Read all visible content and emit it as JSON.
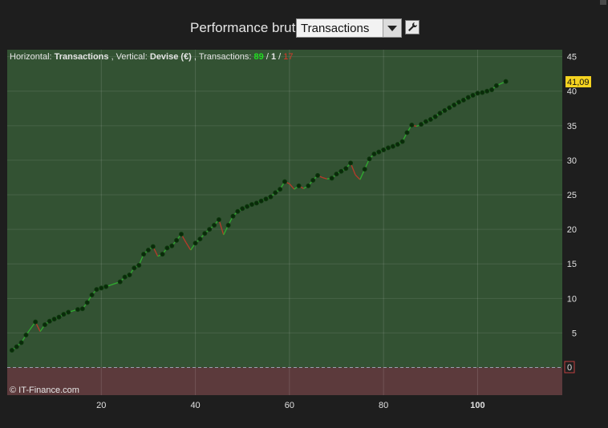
{
  "toolbar": {
    "title": "Performance brute",
    "select_value": "Transactions",
    "wrench_icon": "wrench-icon"
  },
  "info": {
    "horizontal_label": "Horizontal:",
    "horizontal_value": "Transactions",
    "vertical_label": ", Vertical:",
    "vertical_value": "Devise (€)",
    "transactions_label": ", Transactions:",
    "count_win": "89",
    "count_even": "1",
    "count_loss": "17",
    "sep": " / "
  },
  "watermark": "© IT-Finance.com",
  "current_value_label": "41,09",
  "zero_label": "0",
  "colors": {
    "profit_zone": "#335233",
    "loss_zone": "#5c3a3c",
    "up_line": "#2fae2f",
    "down_line": "#b83a2a",
    "marker": "#0a2a0a",
    "win_text": "#22dd22",
    "loss_text": "#d83a2a",
    "value_badge": "#f5d320"
  },
  "chart_data": {
    "type": "line",
    "xlabel": "",
    "ylabel": "",
    "xlim": [
      0,
      118
    ],
    "ylim": [
      -4,
      46
    ],
    "x_ticks": [
      "20",
      "40",
      "60",
      "80",
      "100"
    ],
    "x_tick_values": [
      20,
      40,
      60,
      80,
      100
    ],
    "y_ticks": [
      "5",
      "10",
      "15",
      "20",
      "25",
      "30",
      "35",
      "40",
      "45"
    ],
    "y_tick_values": [
      5,
      10,
      15,
      20,
      25,
      30,
      35,
      40,
      45
    ],
    "grid": true,
    "series": [
      {
        "values": [
          [
            1,
            2.5
          ],
          [
            2,
            3
          ],
          [
            3,
            3.6
          ],
          [
            4,
            4.7
          ],
          [
            6,
            6.6
          ],
          [
            7,
            5.2
          ],
          [
            8,
            6.2
          ],
          [
            9,
            6.7
          ],
          [
            10,
            7
          ],
          [
            11,
            7.3
          ],
          [
            12,
            7.7
          ],
          [
            13,
            8
          ],
          [
            15,
            8.4
          ],
          [
            16,
            8.5
          ],
          [
            17,
            9.4
          ],
          [
            18,
            10.5
          ],
          [
            19,
            11.3
          ],
          [
            20,
            11.5
          ],
          [
            21,
            11.7
          ],
          [
            24,
            12.4
          ],
          [
            25,
            13.1
          ],
          [
            26,
            13.4
          ],
          [
            27,
            14.4
          ],
          [
            28,
            14.8
          ],
          [
            29,
            16.4
          ],
          [
            30,
            17
          ],
          [
            31,
            17.5
          ],
          [
            32,
            16.1
          ],
          [
            33,
            16.4
          ],
          [
            34,
            17.3
          ],
          [
            35,
            17.6
          ],
          [
            36,
            18.4
          ],
          [
            37,
            19.3
          ],
          [
            38,
            18.1
          ],
          [
            39,
            17
          ],
          [
            40,
            18
          ],
          [
            41,
            18.6
          ],
          [
            42,
            19.4
          ],
          [
            43,
            20
          ],
          [
            44,
            20.6
          ],
          [
            45,
            21.4
          ],
          [
            46,
            19.2
          ],
          [
            47,
            20.6
          ],
          [
            48,
            21.9
          ],
          [
            49,
            22.6
          ],
          [
            50,
            23
          ],
          [
            51,
            23.3
          ],
          [
            52,
            23.6
          ],
          [
            53,
            23.8
          ],
          [
            54,
            24.1
          ],
          [
            55,
            24.4
          ],
          [
            56,
            24.7
          ],
          [
            57,
            25.3
          ],
          [
            58,
            25.8
          ],
          [
            59,
            26.9
          ],
          [
            60,
            26.6
          ],
          [
            61,
            25.8
          ],
          [
            62,
            26.3
          ],
          [
            63,
            25.9
          ],
          [
            64,
            26.3
          ],
          [
            65,
            27.1
          ],
          [
            66,
            27.8
          ],
          [
            67,
            27.5
          ],
          [
            68,
            27.3
          ],
          [
            69,
            27.4
          ],
          [
            70,
            28
          ],
          [
            71,
            28.4
          ],
          [
            72,
            28.8
          ],
          [
            73,
            29.6
          ],
          [
            74,
            27.9
          ],
          [
            75,
            27.2
          ],
          [
            76,
            28.7
          ],
          [
            77,
            30.2
          ],
          [
            78,
            30.9
          ],
          [
            79,
            31.2
          ],
          [
            80,
            31.5
          ],
          [
            81,
            31.8
          ],
          [
            82,
            32
          ],
          [
            83,
            32.3
          ],
          [
            84,
            32.7
          ],
          [
            85,
            34
          ],
          [
            86,
            35.1
          ],
          [
            87,
            34.9
          ],
          [
            88,
            35.2
          ],
          [
            89,
            35.6
          ],
          [
            90,
            35.9
          ],
          [
            91,
            36.3
          ],
          [
            92,
            36.8
          ],
          [
            93,
            37.2
          ],
          [
            94,
            37.6
          ],
          [
            95,
            38
          ],
          [
            96,
            38.4
          ],
          [
            97,
            38.7
          ],
          [
            98,
            39.1
          ],
          [
            99,
            39.4
          ],
          [
            100,
            39.7
          ],
          [
            101,
            39.8
          ],
          [
            102,
            40
          ],
          [
            103,
            40.2
          ],
          [
            104,
            40.8
          ],
          [
            106,
            41.4
          ]
        ]
      }
    ]
  }
}
